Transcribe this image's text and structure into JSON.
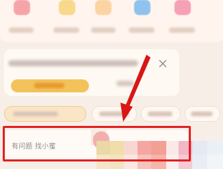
{
  "search": {
    "placeholder": "有问题 找小蜜"
  },
  "colors": {
    "highlight": "#e21f1f",
    "arrow": "#d81616",
    "accent_button": "#f3c25a"
  },
  "icons": {
    "close": "close-icon"
  }
}
